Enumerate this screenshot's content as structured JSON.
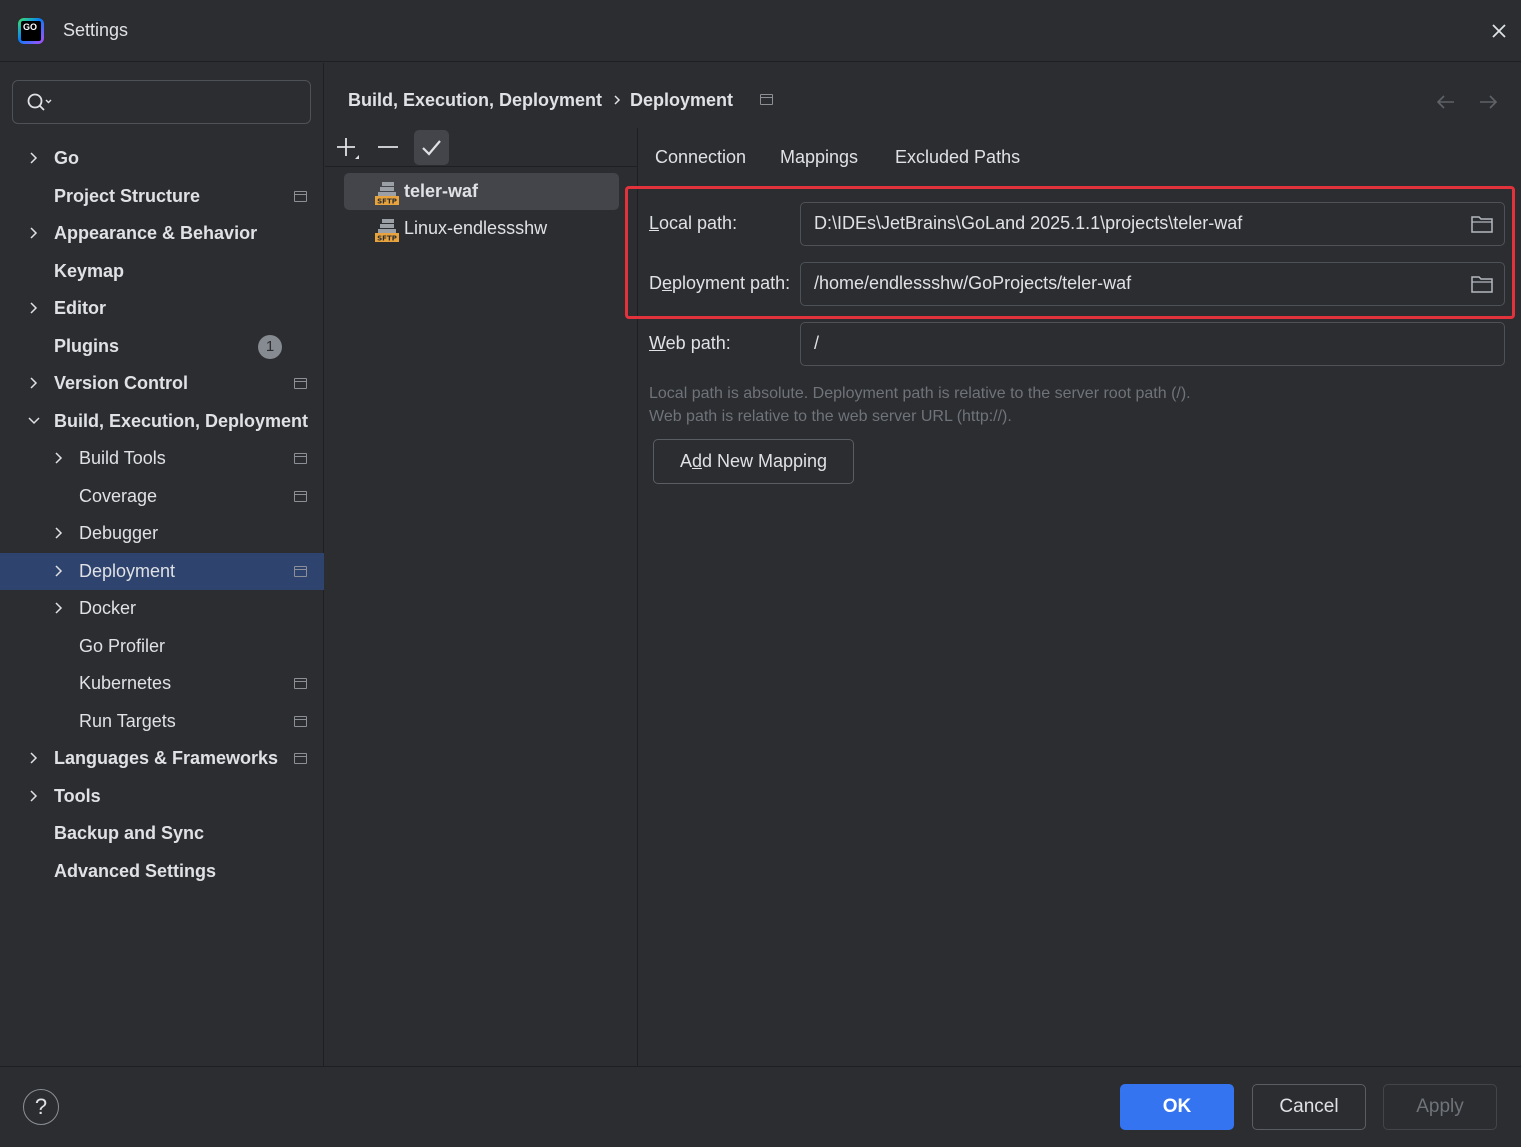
{
  "window": {
    "title": "Settings",
    "logo_text": "GO"
  },
  "search": {
    "placeholder": ""
  },
  "sidebar": {
    "items": [
      {
        "label": "Go",
        "level": 0,
        "expandable": true,
        "expanded": false,
        "bold": true,
        "project_scoped": false
      },
      {
        "label": "Project Structure",
        "level": 0,
        "expandable": false,
        "bold": true,
        "project_scoped": true
      },
      {
        "label": "Appearance & Behavior",
        "level": 0,
        "expandable": true,
        "expanded": false,
        "bold": true,
        "project_scoped": false
      },
      {
        "label": "Keymap",
        "level": 0,
        "expandable": false,
        "bold": true,
        "project_scoped": false
      },
      {
        "label": "Editor",
        "level": 0,
        "expandable": true,
        "expanded": false,
        "bold": true,
        "project_scoped": false
      },
      {
        "label": "Plugins",
        "level": 0,
        "expandable": false,
        "bold": true,
        "project_scoped": false,
        "badge": "1"
      },
      {
        "label": "Version Control",
        "level": 0,
        "expandable": true,
        "expanded": false,
        "bold": true,
        "project_scoped": true
      },
      {
        "label": "Build, Execution, Deployment",
        "level": 0,
        "expandable": true,
        "expanded": true,
        "bold": true,
        "project_scoped": false
      },
      {
        "label": "Build Tools",
        "level": 1,
        "expandable": true,
        "expanded": false,
        "bold": false,
        "project_scoped": true
      },
      {
        "label": "Coverage",
        "level": 1,
        "expandable": false,
        "bold": false,
        "project_scoped": true
      },
      {
        "label": "Debugger",
        "level": 1,
        "expandable": true,
        "expanded": false,
        "bold": false,
        "project_scoped": false
      },
      {
        "label": "Deployment",
        "level": 1,
        "expandable": true,
        "expanded": false,
        "bold": false,
        "project_scoped": true,
        "selected": true
      },
      {
        "label": "Docker",
        "level": 1,
        "expandable": true,
        "expanded": false,
        "bold": false,
        "project_scoped": false
      },
      {
        "label": "Go Profiler",
        "level": 1,
        "expandable": false,
        "bold": false,
        "project_scoped": false
      },
      {
        "label": "Kubernetes",
        "level": 1,
        "expandable": false,
        "bold": false,
        "project_scoped": true
      },
      {
        "label": "Run Targets",
        "level": 1,
        "expandable": false,
        "bold": false,
        "project_scoped": true
      },
      {
        "label": "Languages & Frameworks",
        "level": 0,
        "expandable": true,
        "expanded": false,
        "bold": true,
        "project_scoped": true
      },
      {
        "label": "Tools",
        "level": 0,
        "expandable": true,
        "expanded": false,
        "bold": true,
        "project_scoped": false
      },
      {
        "label": "Backup and Sync",
        "level": 0,
        "expandable": false,
        "bold": true,
        "project_scoped": false
      },
      {
        "label": "Advanced Settings",
        "level": 0,
        "expandable": false,
        "bold": true,
        "project_scoped": false
      }
    ]
  },
  "breadcrumb": {
    "parent": "Build, Execution, Deployment",
    "current": "Deployment"
  },
  "servers": [
    {
      "name": "teler-waf",
      "selected": true,
      "default": true
    },
    {
      "name": "Linux-endlessshw",
      "selected": false,
      "default": false
    }
  ],
  "tabs": [
    {
      "label": "Connection",
      "active": false
    },
    {
      "label": "Mappings",
      "active": true
    },
    {
      "label": "Excluded Paths",
      "active": false
    }
  ],
  "mappings": {
    "local_path": {
      "label_mnemonic": "L",
      "label_rest": "ocal path:",
      "value": "D:\\IDEs\\JetBrains\\GoLand 2025.1.1\\projects\\teler-waf"
    },
    "deployment_path": {
      "label_start": "D",
      "label_mnemonic": "e",
      "label_rest": "ployment path:",
      "value": "/home/endlessshw/GoProjects/teler-waf"
    },
    "web_path": {
      "label_mnemonic": "W",
      "label_rest": "eb path:",
      "value": "/"
    },
    "hint_line1": "Local path is absolute. Deployment path is relative to the server root path (/).",
    "hint_line2": "Web path is relative to the web server URL (http://).",
    "add_button": {
      "before": "A",
      "mnemonic": "d",
      "after": "d New Mapping"
    }
  },
  "footer": {
    "help": "?",
    "ok": "OK",
    "cancel": "Cancel",
    "apply": "Apply"
  },
  "colors": {
    "background": "#2b2d30",
    "selection": "#2e436e",
    "accent": "#3574f0",
    "highlight": "#e2323c"
  }
}
